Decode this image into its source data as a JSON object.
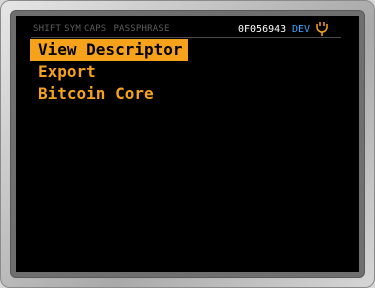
{
  "status": {
    "indicators": [
      "SHIFT",
      "SYM",
      "CAPS"
    ],
    "passphrase_label": "PASSPHRASE",
    "serial": "0F056943",
    "mode": "DEV",
    "power_icon": "plug-icon",
    "colors": {
      "dim": "#5d5d5d",
      "serial": "#ffffff",
      "mode": "#3aa7ff",
      "power": "#f7a21b"
    }
  },
  "menu": {
    "selected_index": 0,
    "items": [
      {
        "label": "View Descriptor"
      },
      {
        "label": "Export"
      },
      {
        "label": "Bitcoin Core"
      }
    ],
    "colors": {
      "accent": "#f7a21b",
      "background": "#000000"
    }
  }
}
